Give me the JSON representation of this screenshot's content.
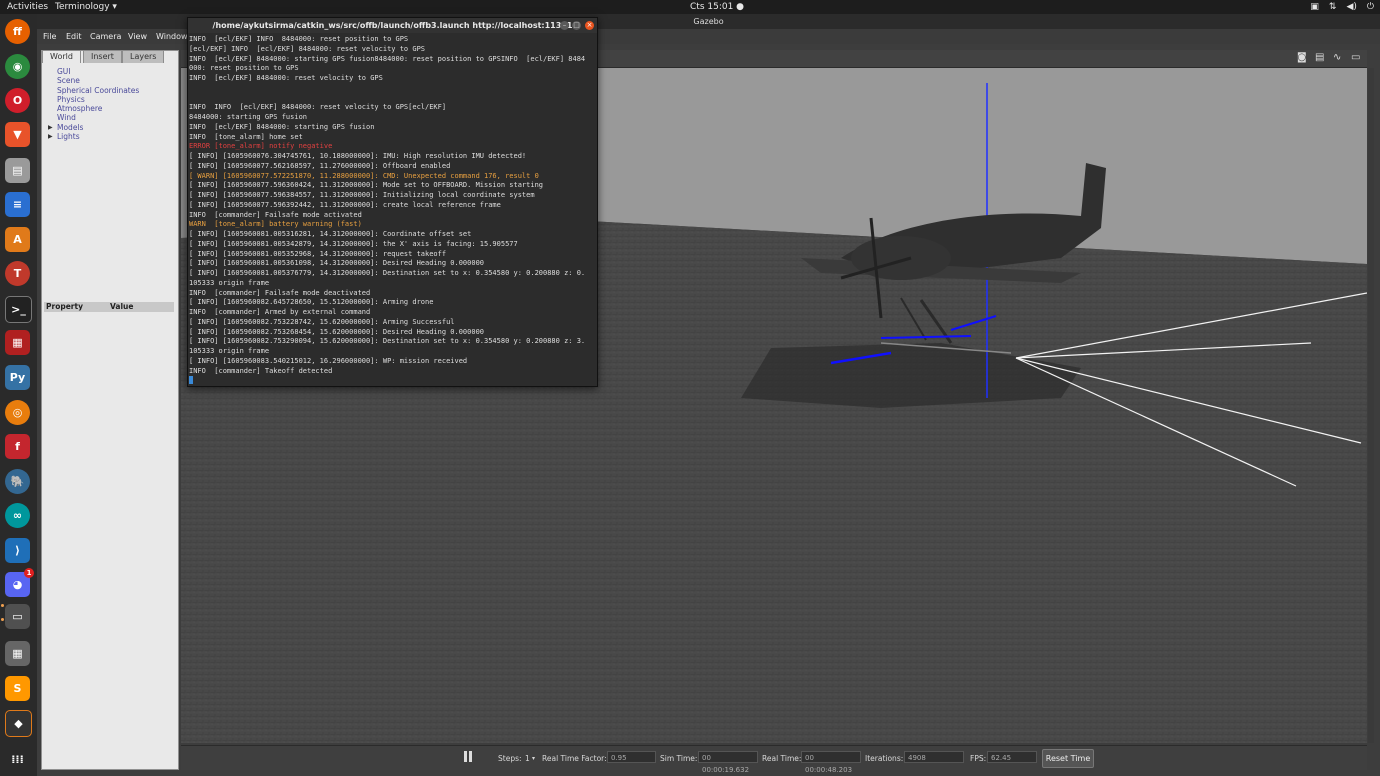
{
  "topbar": {
    "activities": "Activities",
    "app_menu": "Terminology ▾",
    "clock": "Cts 15:01 ●",
    "tray_icons": [
      "discord-icon",
      "network-icon",
      "volume-icon",
      "power-icon"
    ]
  },
  "dock": {
    "items": [
      "firefox",
      "chrome",
      "opera",
      "brave",
      "files",
      "text-editor",
      "software",
      "tex",
      "terminal",
      "monitor",
      "python",
      "blender",
      "fontforge",
      "postgres",
      "arduino",
      "vscode",
      "discord",
      "terminology",
      "calculator",
      "sublime",
      "stack",
      "app-grid"
    ],
    "discord_badge": "1"
  },
  "gazebo": {
    "title": "Gazebo",
    "menu": [
      "File",
      "Edit",
      "Camera",
      "View",
      "Window"
    ],
    "tabs": [
      "World",
      "Insert",
      "Layers"
    ],
    "tree": [
      "GUI",
      "Scene",
      "Spherical Coordinates",
      "Physics",
      "Atmosphere",
      "Wind",
      "Models",
      "Lights"
    ],
    "property_header": [
      "Property",
      "Value"
    ],
    "toolbar_icons": [
      "screenshot-icon",
      "log-icon",
      "plot-icon",
      "video-icon"
    ],
    "bottom": {
      "steps_label": "Steps:",
      "steps_value": "1",
      "rtf_label": "Real Time Factor:",
      "rtf_value": "0.95",
      "sim_time_label": "Sim Time:",
      "sim_time_value": "00 00:00:19.632",
      "real_time_label": "Real Time:",
      "real_time_value": "00 00:00:48.203",
      "iterations_label": "Iterations:",
      "iterations_value": "4908",
      "fps_label": "FPS:",
      "fps_value": "62.45",
      "reset_button": "Reset Time"
    }
  },
  "terminal": {
    "title": "/home/aykutsirma/catkin_ws/src/offb/launch/offb3.launch http://localhost:11311",
    "lines": [
      {
        "t": "INFO  [ecl/EKF] INFO  8484000: reset position to GPS",
        "c": ""
      },
      {
        "t": "[ecl/EKF] INFO  [ecl/EKF] 8484000: reset velocity to GPS",
        "c": ""
      },
      {
        "t": "INFO  [ecl/EKF] 8484000: starting GPS fusion8484000: reset position to GPSINFO  [ecl/EKF] 8484",
        "c": ""
      },
      {
        "t": "000: reset position to GPS",
        "c": ""
      },
      {
        "t": "INFO  [ecl/EKF] 8484000: reset velocity to GPS",
        "c": ""
      },
      {
        "t": "",
        "c": ""
      },
      {
        "t": "",
        "c": ""
      },
      {
        "t": "INFO  INFO  [ecl/EKF] 8484000: reset velocity to GPS[ecl/EKF]",
        "c": ""
      },
      {
        "t": "8484000: starting GPS fusion",
        "c": ""
      },
      {
        "t": "INFO  [ecl/EKF] 8484000: starting GPS fusion",
        "c": ""
      },
      {
        "t": "INFO  [tone_alarm] home set",
        "c": ""
      },
      {
        "t": "ERROR [tone_alarm] notify negative",
        "c": "err"
      },
      {
        "t": "[ INFO] [1605960076.304745761, 10.188000000]: IMU: High resolution IMU detected!",
        "c": ""
      },
      {
        "t": "[ INFO] [1605960077.562168597, 11.276000000]: Offboard enabled",
        "c": ""
      },
      {
        "t": "[ WARN] [1605960077.572251870, 11.288000000]: CMD: Unexpected command 176, result 0",
        "c": "warnc"
      },
      {
        "t": "[ INFO] [1605960077.596360424, 11.312000000]: Mode set to OFFBOARD. Mission starting",
        "c": ""
      },
      {
        "t": "[ INFO] [1605960077.596384557, 11.312000000]: Initializing local coordinate system",
        "c": ""
      },
      {
        "t": "[ INFO] [1605960077.596392442, 11.312000000]: create local reference frame",
        "c": ""
      },
      {
        "t": "INFO  [commander] Failsafe mode activated",
        "c": ""
      },
      {
        "t": "WARN  [tone_alarm] battery warning (fast)",
        "c": "warnc"
      },
      {
        "t": "[ INFO] [1605960081.005316281, 14.312000000]: Coordinate offset set",
        "c": ""
      },
      {
        "t": "[ INFO] [1605960081.005342879, 14.312000000]: the X' axis is facing: 15.905577",
        "c": ""
      },
      {
        "t": "[ INFO] [1605960081.005352968, 14.312000000]: request takeoff",
        "c": ""
      },
      {
        "t": "[ INFO] [1605960081.005361098, 14.312000000]: Desired Heading 0.000000",
        "c": ""
      },
      {
        "t": "[ INFO] [1605960081.005376779, 14.312000000]: Destination set to x: 0.354580 y: 0.200880 z: 0.",
        "c": ""
      },
      {
        "t": "105333 origin frame",
        "c": ""
      },
      {
        "t": "INFO  [commander] Failsafe mode deactivated",
        "c": ""
      },
      {
        "t": "[ INFO] [1605960082.645728650, 15.512000000]: Arming drone",
        "c": ""
      },
      {
        "t": "INFO  [commander] Armed by external command",
        "c": ""
      },
      {
        "t": "[ INFO] [1605960082.753228742, 15.620000000]: Arming Successful",
        "c": ""
      },
      {
        "t": "[ INFO] [1605960082.753268454, 15.620000000]: Desired Heading 0.000000",
        "c": ""
      },
      {
        "t": "[ INFO] [1605960082.753290094, 15.620000000]: Destination set to x: 0.354580 y: 0.200880 z: 3.",
        "c": ""
      },
      {
        "t": "105333 origin frame",
        "c": ""
      },
      {
        "t": "[ INFO] [1605960083.540215012, 16.296000000]: WP: mission received",
        "c": ""
      },
      {
        "t": "INFO  [commander] Takeoff detected",
        "c": ""
      }
    ]
  }
}
